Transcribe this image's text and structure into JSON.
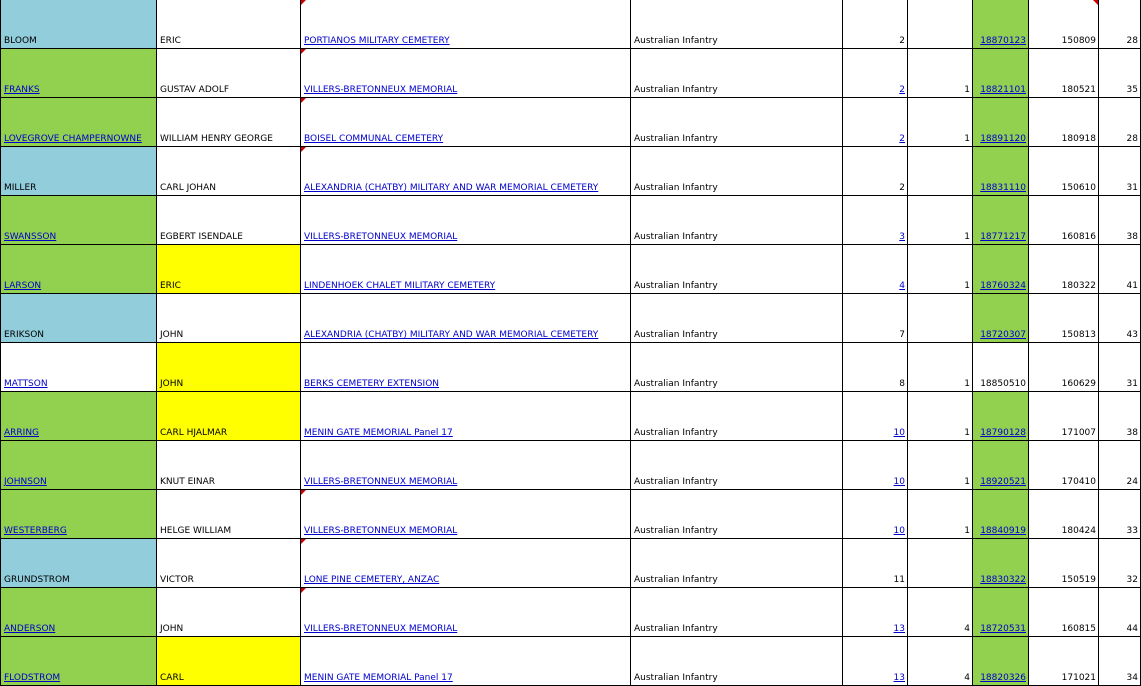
{
  "colors": {
    "blue": "#92cddc",
    "green": "#92d050",
    "yellow": "#ffff00",
    "link": "#0000cc",
    "comment": "#cc0000"
  },
  "rows": [
    {
      "surname": "BLOOM",
      "given": "ERIC",
      "cemetery": "PORTIANOS MILITARY CEMETERY",
      "unit": "Australian Infantry",
      "c5": "2",
      "c6": "",
      "date": "18870123",
      "c8": "150809",
      "c9": "28"
    },
    {
      "surname": "FRANKS",
      "given": "GUSTAV ADOLF",
      "cemetery": "VILLERS-BRETONNEUX MEMORIAL",
      "unit": "Australian Infantry",
      "c5": "2",
      "c6": "1",
      "date": "18821101",
      "c8": "180521",
      "c9": "35"
    },
    {
      "surname": "LOVEGROVE CHAMPERNOWNE",
      "given": "WILLIAM HENRY GEORGE",
      "cemetery": "BOISEL COMMUNAL CEMETERY",
      "unit": "Australian Infantry",
      "c5": "2",
      "c6": "1",
      "date": "18891120",
      "c8": "180918",
      "c9": "28"
    },
    {
      "surname": "MILLER",
      "given": "CARL JOHAN",
      "cemetery": "ALEXANDRIA (CHATBY) MILITARY AND WAR MEMORIAL CEMETERY",
      "unit": "Australian Infantry",
      "c5": "2",
      "c6": "",
      "date": "18831110",
      "c8": "150610",
      "c9": "31"
    },
    {
      "surname": "SWANSSON",
      "given": "EGBERT ISENDALE",
      "cemetery": "VILLERS-BRETONNEUX MEMORIAL",
      "unit": "Australian Infantry",
      "c5": "3",
      "c6": "1",
      "date": "18771217",
      "c8": "160816",
      "c9": "38"
    },
    {
      "surname": "LARSON",
      "given": "ERIC",
      "cemetery": "LINDENHOEK CHALET MILITARY CEMETERY",
      "unit": "Australian Infantry",
      "c5": "4",
      "c6": "1",
      "date": "18760324",
      "c8": "180322",
      "c9": "41"
    },
    {
      "surname": "ERIKSON",
      "given": "JOHN",
      "cemetery": "ALEXANDRIA (CHATBY) MILITARY AND WAR MEMORIAL CEMETERY",
      "unit": "Australian Infantry",
      "c5": "7",
      "c6": "",
      "date": "18720307",
      "c8": "150813",
      "c9": "43"
    },
    {
      "surname": "MATTSON",
      "given": "JOHN",
      "cemetery": "BERKS CEMETERY EXTENSION",
      "unit": "Australian Infantry",
      "c5": "8",
      "c6": "1",
      "date": "18850510",
      "c8": "160629",
      "c9": "31"
    },
    {
      "surname": "ARRING",
      "given": "CARL HJALMAR",
      "cemetery": "MENIN GATE MEMORIAL Panel 17",
      "unit": "Australian Infantry",
      "c5": "10",
      "c6": "1",
      "date": "18790128",
      "c8": "171007",
      "c9": "38"
    },
    {
      "surname": "JOHNSON",
      "given": "KNUT EINAR",
      "cemetery": "VILLERS-BRETONNEUX MEMORIAL",
      "unit": "Australian Infantry",
      "c5": "10",
      "c6": "1",
      "date": "18920521",
      "c8": "170410",
      "c9": "24"
    },
    {
      "surname": "WESTERBERG",
      "given": "HELGE WILLIAM",
      "cemetery": "VILLERS-BRETONNEUX MEMORIAL",
      "unit": "Australian Infantry",
      "c5": "10",
      "c6": "1",
      "date": "18840919",
      "c8": "180424",
      "c9": "33"
    },
    {
      "surname": "GRUNDSTROM",
      "given": "VICTOR",
      "cemetery": "LONE PINE CEMETERY, ANZAC",
      "unit": "Australian Infantry",
      "c5": "11",
      "c6": "",
      "date": "18830322",
      "c8": "150519",
      "c9": "32"
    },
    {
      "surname": "ANDERSON",
      "given": "JOHN",
      "cemetery": "VILLERS-BRETONNEUX MEMORIAL",
      "unit": "Australian Infantry",
      "c5": "13",
      "c6": "4",
      "date": "18720531",
      "c8": "160815",
      "c9": "44"
    },
    {
      "surname": "FLODSTROM",
      "given": "CARL",
      "cemetery": "MENIN GATE MEMORIAL Panel 17",
      "unit": "Australian Infantry",
      "c5": "13",
      "c6": "4",
      "date": "18820326",
      "c8": "171021",
      "c9": "34"
    }
  ]
}
